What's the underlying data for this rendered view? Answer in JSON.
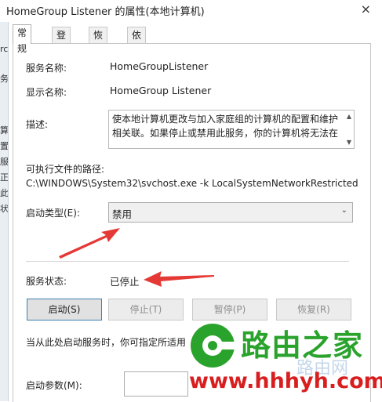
{
  "window": {
    "title": "HomeGroup Listener 的属性(本地计算机)",
    "close_glyph": "×"
  },
  "background_window_fragments": [
    "rc",
    "务",
    "算",
    "置",
    "服",
    "正",
    "此",
    "状"
  ],
  "tabs": [
    "常规",
    "登录",
    "恢复",
    "依存关系"
  ],
  "general": {
    "service_name_label": "服务名称:",
    "service_name": "HomeGroupListener",
    "display_name_label": "显示名称:",
    "display_name": "HomeGroup Listener",
    "description_label": "描述:",
    "description": "使本地计算机更改与加入家庭组的计算机的配置和维护相关联。如果停止或禁用此服务，你的计算机将无法在",
    "path_label": "可执行文件的路径:",
    "path": "C:\\WINDOWS\\System32\\svchost.exe -k LocalSystemNetworkRestricted",
    "startup_type_label": "启动类型(E):",
    "startup_type": "禁用",
    "status_label": "服务状态:",
    "status": "已停止",
    "buttons": {
      "start": "启动(S)",
      "stop": "停止(T)",
      "pause": "暂停(P)",
      "resume": "恢复(R)"
    },
    "hint": "当从此处启动服务时，你可指定所适用",
    "start_params_label": "启动参数(M):"
  },
  "watermark": {
    "title": "路由之家",
    "url": "www.hhhyh.com",
    "faint": "路由网"
  },
  "colors": {
    "arrow": "#e53935",
    "watermark_green": "#2aa32c",
    "watermark_red": "#d81e1e"
  }
}
